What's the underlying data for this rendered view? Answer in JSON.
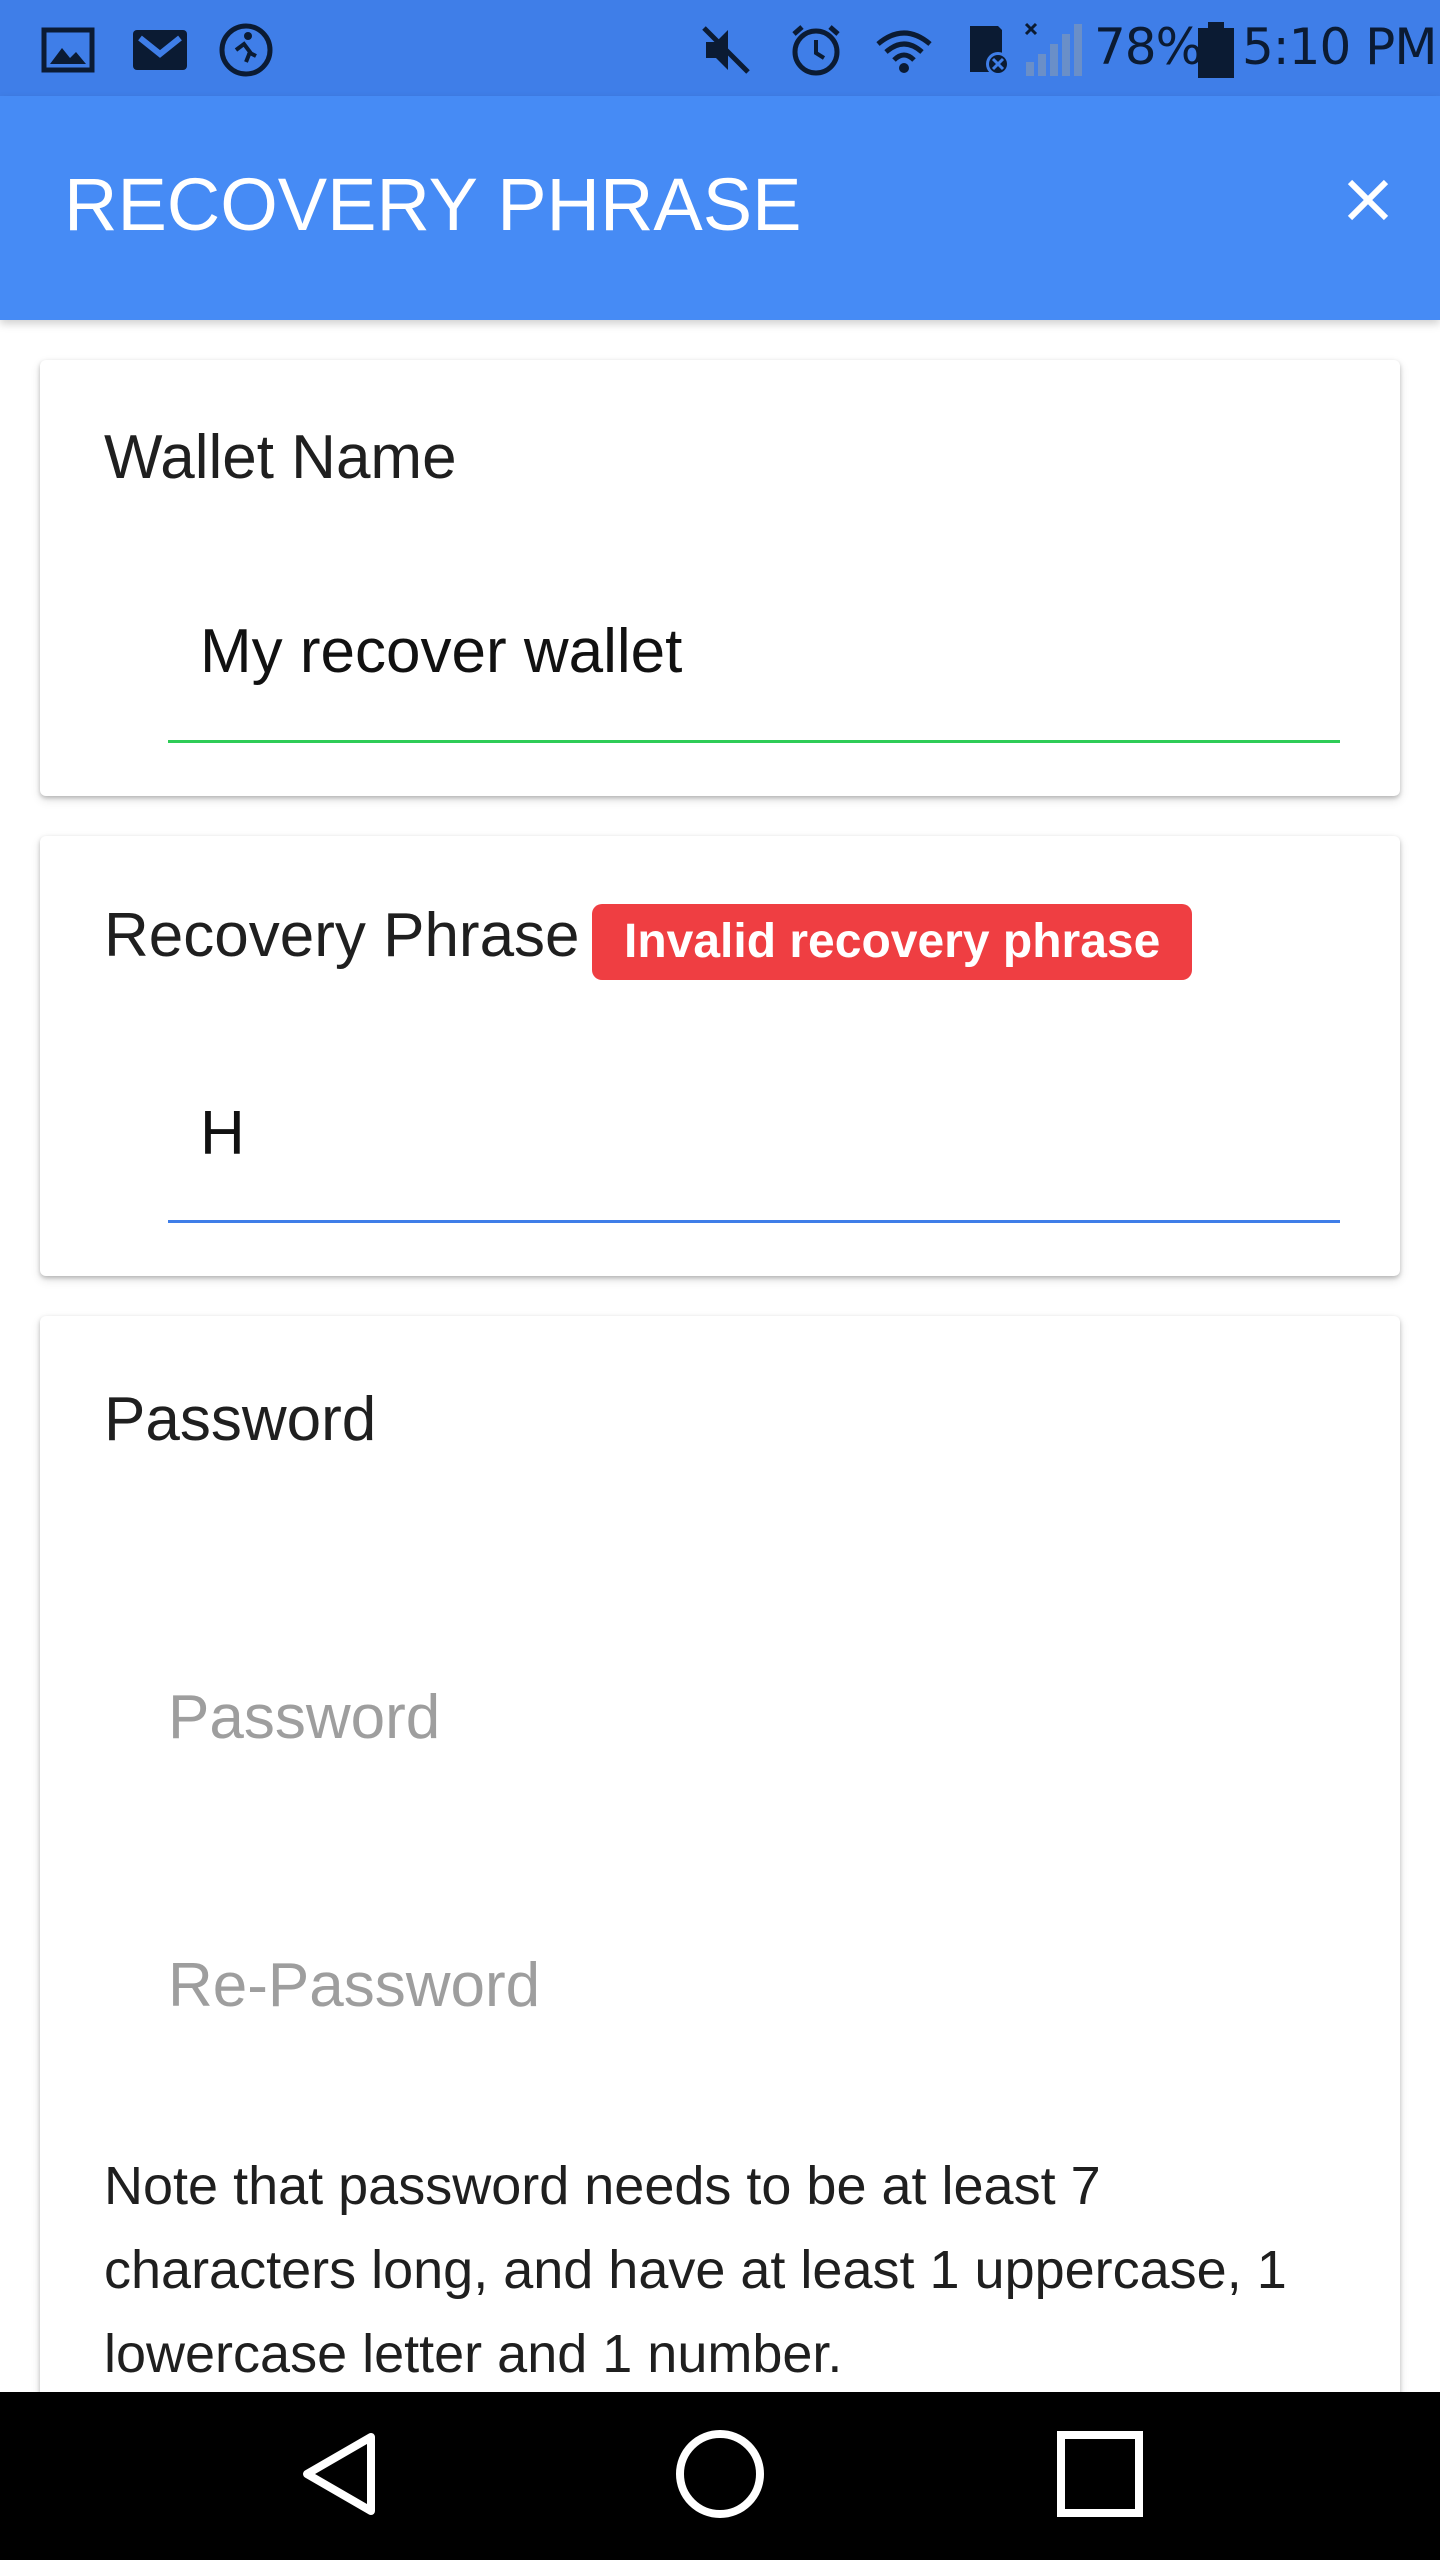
{
  "status_bar": {
    "battery_text": "78%",
    "time": "5:10 PM",
    "left_icons": [
      "gallery-icon",
      "gmail-icon",
      "activity-icon"
    ],
    "right_icons": [
      "mute-icon",
      "alarm-icon",
      "wifi-icon",
      "sd-card-icon",
      "signal-icon",
      "battery-icon"
    ]
  },
  "app_bar": {
    "title": "RECOVERY PHRASE",
    "close_icon": "close-icon",
    "background": "#468bf5"
  },
  "wallet_name": {
    "label": "Wallet Name",
    "value": "My recover wallet",
    "underline_color": "#2ecc57"
  },
  "recovery_phrase": {
    "label": "Recovery Phrase",
    "error_badge": "Invalid recovery phrase",
    "value": "H",
    "underline_color": "#3f7ee8",
    "badge_color": "#ef3e42"
  },
  "password": {
    "label": "Password",
    "password_placeholder": "Password",
    "repassword_placeholder": "Re-Password",
    "note": "Note that password needs to be at least 7 characters long, and have at least 1 uppercase, 1 lowercase letter and 1 number."
  },
  "nav_bar": {
    "icons": [
      "back-icon",
      "home-icon",
      "recents-icon"
    ]
  }
}
